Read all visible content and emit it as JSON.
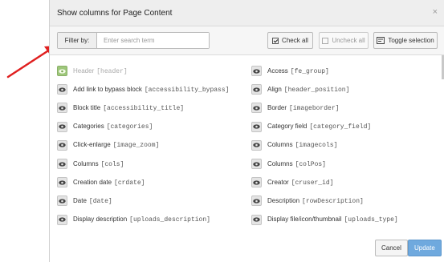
{
  "modal": {
    "title": "Show columns for Page Content",
    "close_label": "×"
  },
  "toolbar": {
    "filter_label": "Filter by:",
    "filter_placeholder": "Enter search term",
    "filter_value": "",
    "check_all_label": "Check all",
    "uncheck_all_label": "Uncheck all",
    "toggle_selection_label": "Toggle selection"
  },
  "columns": {
    "left": [
      {
        "label": "Header",
        "field": "[header]",
        "active": true
      },
      {
        "label": "Add link to bypass block",
        "field": "[accessibility_bypass]"
      },
      {
        "label": "Block title",
        "field": "[accessibility_title]"
      },
      {
        "label": "Categories",
        "field": "[categories]"
      },
      {
        "label": "Click-enlarge",
        "field": "[image_zoom]"
      },
      {
        "label": "Columns",
        "field": "[cols]"
      },
      {
        "label": "Creation date",
        "field": "[crdate]"
      },
      {
        "label": "Date",
        "field": "[date]"
      },
      {
        "label": "Display description",
        "field": "[uploads_description]"
      }
    ],
    "right": [
      {
        "label": "Access",
        "field": "[fe_group]"
      },
      {
        "label": "Align",
        "field": "[header_position]"
      },
      {
        "label": "Border",
        "field": "[imageborder]"
      },
      {
        "label": "Category field",
        "field": "[category_field]"
      },
      {
        "label": "Columns",
        "field": "[imagecols]"
      },
      {
        "label": "Columns",
        "field": "[colPos]"
      },
      {
        "label": "Creator",
        "field": "[cruser_id]"
      },
      {
        "label": "Description",
        "field": "[rowDescription]"
      },
      {
        "label": "Display file/icon/thumbnail",
        "field": "[uploads_type]"
      }
    ]
  },
  "footer": {
    "cancel_label": "Cancel",
    "update_label": "Update"
  },
  "colors": {
    "annotation_arrow": "#e02020",
    "active_eye": "#9ec77b",
    "primary_button": "#6fa9de"
  },
  "icons": {
    "eye": "eye-icon",
    "check_all": "checkbox-checked-icon",
    "uncheck_all": "checkbox-empty-icon",
    "toggle": "toggle-selection-icon",
    "close": "close-icon",
    "annotation": "red-arrow-icon"
  }
}
